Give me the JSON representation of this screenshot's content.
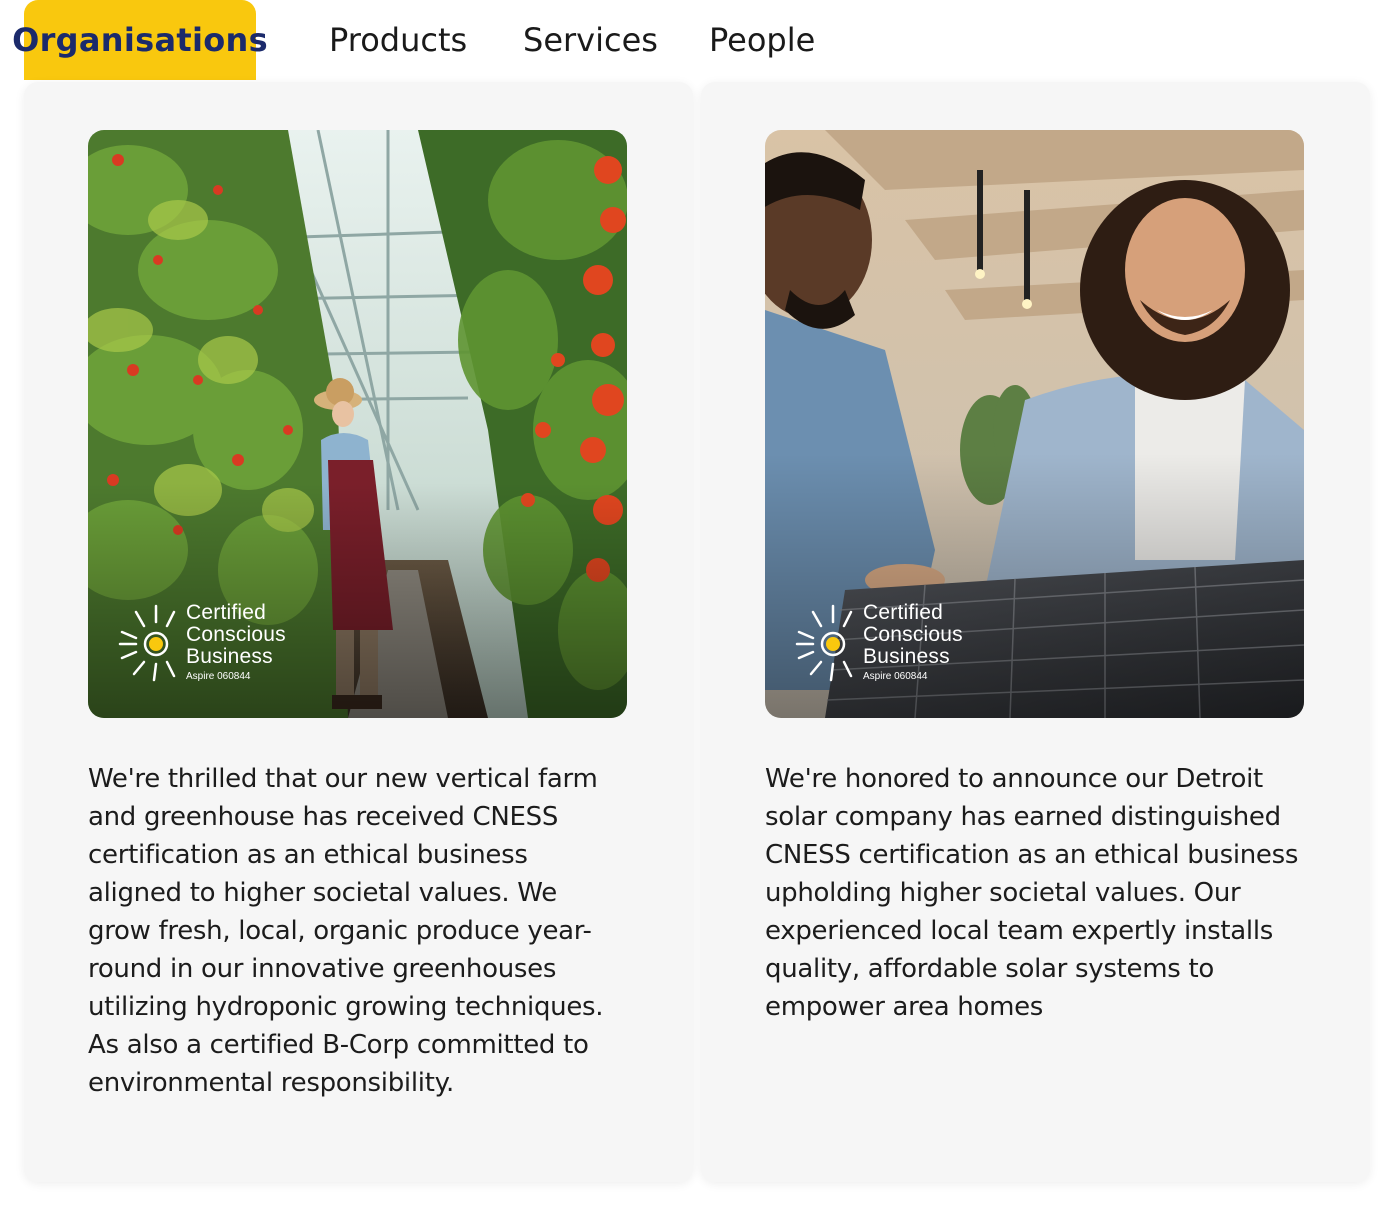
{
  "tabs": [
    {
      "label": "Organisations",
      "active": true
    },
    {
      "label": "Products",
      "active": false
    },
    {
      "label": "Services",
      "active": false
    },
    {
      "label": "People",
      "active": false
    }
  ],
  "colors": {
    "accent": "#f9c80e",
    "active_tab_text": "#1b2a6b",
    "card_background": "#f6f6f6"
  },
  "cards": [
    {
      "badge": {
        "line1": "Certified",
        "line2": "Conscious",
        "line3": "Business",
        "sub": "Aspire 060844",
        "icon": "sun-icon"
      },
      "text": "We're thrilled that our new vertical farm\nand greenhouse has received CNESS\ncertification as an ethical business\naligned to higher societal values. We\ngrow fresh, local, organic produce year-\nround in our innovative greenhouses\nutilizing hydroponic growing techniques.\nAs also a certified B-Corp committed to\nenvironmental responsibility."
    },
    {
      "badge": {
        "line1": "Certified",
        "line2": "Conscious",
        "line3": "Business",
        "sub": "Aspire 060844",
        "icon": "sun-icon"
      },
      "text": "We're honored to announce our Detroit\nsolar company has earned distinguished\nCNESS certification as an ethical business\nupholding  higher societal values. Our\nexperienced local team expertly installs\nquality, affordable solar systems to\nempower area homes"
    }
  ]
}
